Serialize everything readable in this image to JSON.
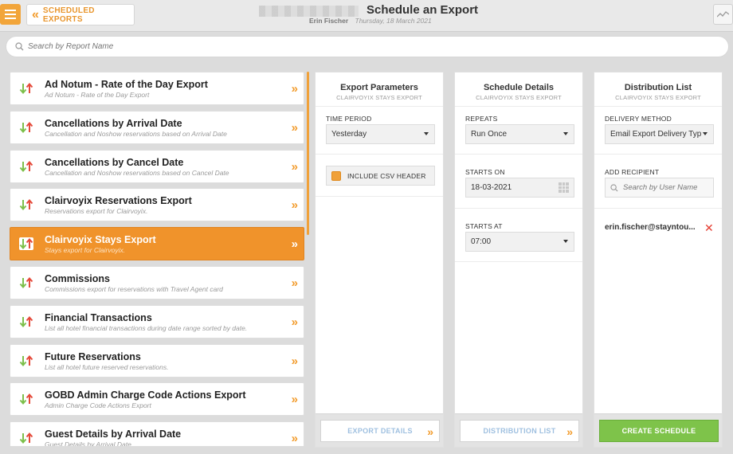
{
  "header": {
    "back_label": "SCHEDULED EXPORTS",
    "title": "Schedule an Export",
    "user": "Erin Fischer",
    "date": "Thursday, 18 March 2021"
  },
  "search": {
    "placeholder": "Search by Report Name"
  },
  "reports": [
    {
      "name": "Ad Notum - Rate of the Day Export",
      "desc": "Ad Notum - Rate of the Day Export"
    },
    {
      "name": "Cancellations by Arrival Date",
      "desc": "Cancellation and Noshow reservations based on Arrival Date"
    },
    {
      "name": "Cancellations by Cancel Date",
      "desc": "Cancellation and Noshow reservations based on Cancel Date"
    },
    {
      "name": "Clairvoyix Reservations Export",
      "desc": "Reservations export for Clairvoyix."
    },
    {
      "name": "Clairvoyix Stays Export",
      "desc": "Stays export for Clairvoyix.",
      "active": true
    },
    {
      "name": "Commissions",
      "desc": "Commissions export for reservations with Travel Agent card"
    },
    {
      "name": "Financial Transactions",
      "desc": "List all hotel financial transactions during date range sorted by date."
    },
    {
      "name": "Future Reservations",
      "desc": "List all hotel future reserved reservations."
    },
    {
      "name": "GOBD Admin Charge Code Actions Export",
      "desc": "Admin Charge Code Actions Export"
    },
    {
      "name": "Guest Details by Arrival Date",
      "desc": "Guest Details by Arrival Date"
    }
  ],
  "export_params": {
    "title": "Export Parameters",
    "subtitle": "CLAIRVOYIX STAYS EXPORT",
    "time_period_label": "TIME PERIOD",
    "time_period_value": "Yesterday",
    "csv_header_label": "INCLUDE CSV HEADER",
    "footer_label": "EXPORT DETAILS"
  },
  "schedule": {
    "title": "Schedule Details",
    "subtitle": "CLAIRVOYIX STAYS EXPORT",
    "repeats_label": "REPEATS",
    "repeats_value": "Run Once",
    "starts_on_label": "STARTS ON",
    "starts_on_value": "18-03-2021",
    "starts_at_label": "STARTS AT",
    "starts_at_value": "07:00",
    "footer_label": "DISTRIBUTION LIST"
  },
  "distribution": {
    "title": "Distribution List",
    "subtitle": "CLAIRVOYIX STAYS EXPORT",
    "delivery_label": "DELIVERY METHOD",
    "delivery_value": "Email Export Delivery Type",
    "add_recipient_label": "ADD RECIPIENT",
    "recipient_placeholder": "Search by User Name",
    "recipient": "erin.fischer@stayntou...",
    "create_label": "CREATE SCHEDULE"
  },
  "colors": {
    "accent": "#f0932b",
    "success": "#7ec34a",
    "danger": "#e53c30",
    "link": "#9fc0e0"
  }
}
